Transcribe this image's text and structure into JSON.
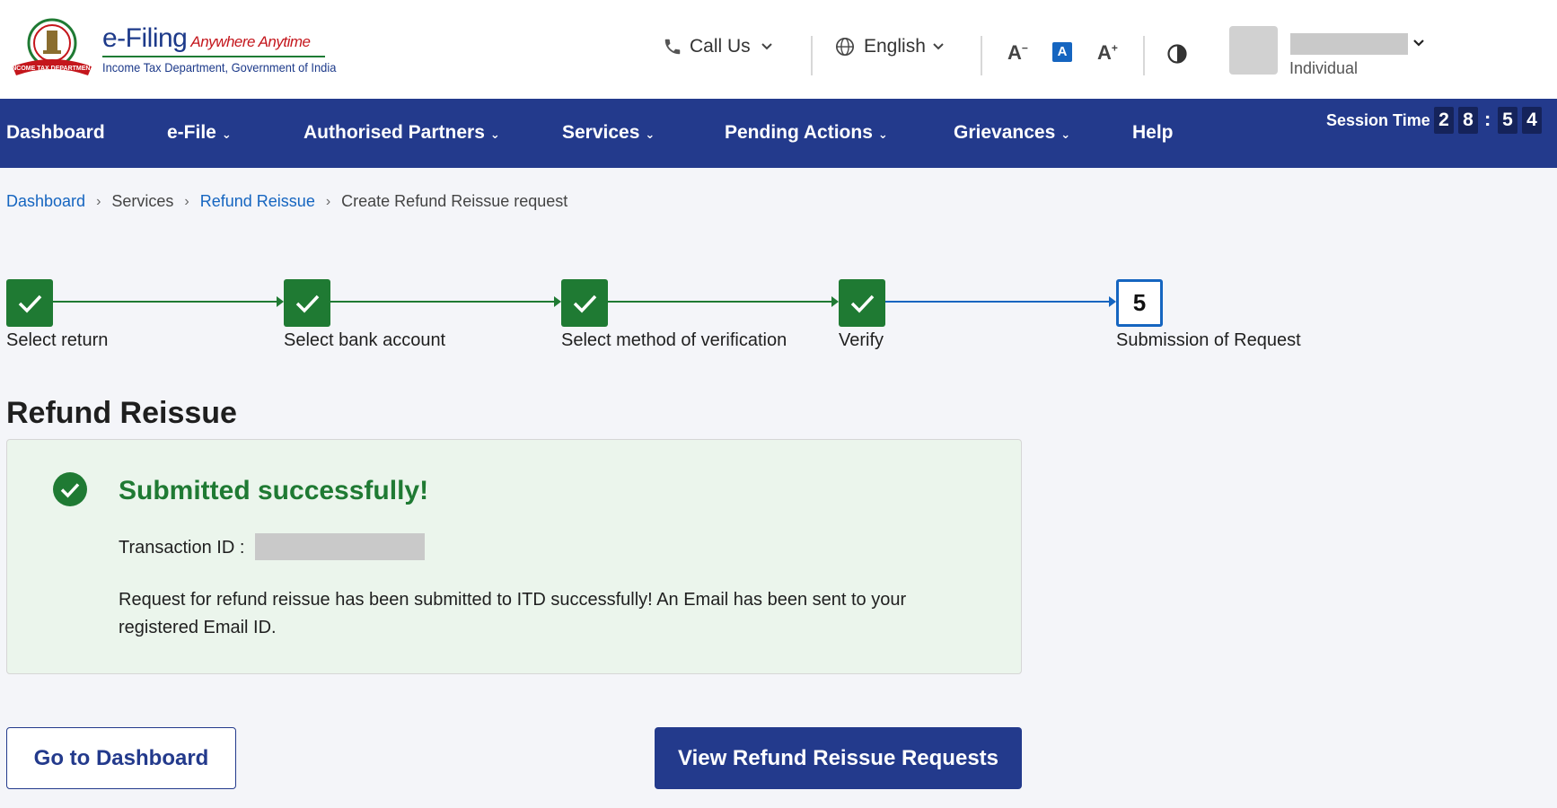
{
  "brand": {
    "title": "e-Filing",
    "tagline": "Anywhere Anytime",
    "subtitle": "Income Tax Department, Government of India",
    "logo_text": "INCOME TAX DEPARTMENT"
  },
  "header": {
    "call_us": "Call Us",
    "language": "English",
    "font_decrease": "A",
    "font_normal": "A",
    "font_increase": "A",
    "user_role": "Individual"
  },
  "nav": {
    "items": [
      {
        "label": "Dashboard",
        "has_dropdown": false
      },
      {
        "label": "e-File",
        "has_dropdown": true
      },
      {
        "label": "Authorised Partners",
        "has_dropdown": true
      },
      {
        "label": "Services",
        "has_dropdown": true
      },
      {
        "label": "Pending Actions",
        "has_dropdown": true
      },
      {
        "label": "Grievances",
        "has_dropdown": true
      },
      {
        "label": "Help",
        "has_dropdown": false
      }
    ],
    "session_label": "Session Time",
    "session_digits": [
      "2",
      "8",
      "5",
      "4"
    ]
  },
  "breadcrumb": [
    "Dashboard",
    "Services",
    "Refund Reissue",
    "Create Refund Reissue request"
  ],
  "stepper": {
    "steps": [
      {
        "label": "Select return",
        "status": "done"
      },
      {
        "label": "Select bank account",
        "status": "done"
      },
      {
        "label": "Select method of verification",
        "status": "done"
      },
      {
        "label": "Verify",
        "status": "done"
      },
      {
        "label": "Submission of Request",
        "status": "current",
        "number": "5"
      }
    ]
  },
  "main": {
    "title": "Refund Reissue",
    "success_heading": "Submitted successfully!",
    "transaction_label": "Transaction ID :",
    "message": "Request for refund reissue has been submitted to ITD successfully! An Email has been sent to your registered Email ID."
  },
  "actions": {
    "go_dashboard": "Go to Dashboard",
    "view_requests": "View Refund Reissue Requests"
  },
  "colors": {
    "nav_bg": "#233a8c",
    "success_green": "#1f7a33",
    "link_blue": "#1565c0",
    "card_bg": "#ebf5ec"
  }
}
